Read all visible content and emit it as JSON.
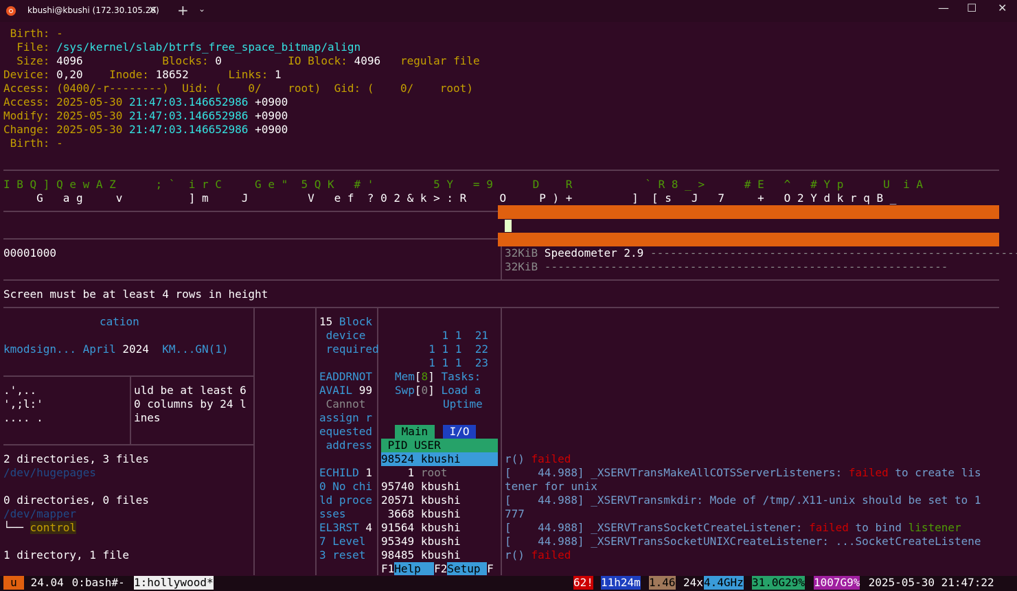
{
  "window": {
    "tab_title": "kbushi@kbushi (172.30.105.26)",
    "tab_close": "✕",
    "new_tab": "+",
    "dropdown": "⌄",
    "minimize": "—",
    "maximize": "☐",
    "close": "✕"
  },
  "stat": {
    "birth1_label": " Birth:",
    "birth1_val": " -",
    "file_label": "  File:",
    "file_val": " /sys/kernel/slab/btrfs_free_space_bitmap/align",
    "size_label": "  Size:",
    "size_val": " 4096",
    "blocks_label": "            Blocks:",
    "blocks_val": " 0",
    "ioblock_label": "          IO Block:",
    "ioblock_val": " 4096",
    "type": "   regular file",
    "device_label": "Device:",
    "device_val": " 0,20",
    "inode_label": "    Inode:",
    "inode_val": " 18652",
    "links_label": "      Links:",
    "links_val": " 1",
    "access_perm_label": "Access:",
    "access_perm_val": " (0400/-r--------)",
    "uid_label": "  Uid:",
    "uid_val": " (    0/    root)",
    "gid_label": "  Gid:",
    "gid_val": " (    0/    root)",
    "access_label": "Access:",
    "access_date": " 2025-05-30",
    "access_time": " 21:47:03.146652986",
    "access_tz": " +0900",
    "modify_label": "Modify:",
    "modify_date": " 2025-05-30",
    "modify_time": " 21:47:03.146652986",
    "modify_tz": " +0900",
    "change_label": "Change:",
    "change_date": " 2025-05-30",
    "change_time": " 21:47:03.146652986",
    "change_tz": " +0900",
    "birth2_label": " Birth:",
    "birth2_val": " -"
  },
  "rain": {
    "row1": "I B Q ] Q e w A Z      ; `  i r C     G e \"  5 Q K   # '         5 Y   = 9      D    R           ` R 8 _ >      # E   ^   # Y p      U  i A",
    "row2": "     G   a g     v          ] m     J         V   e f  ? 0 2 & k > : R     O     P ) +         ]  [ s   J   7     +   O 2 Y d k r q B _"
  },
  "hex_line": "00001000",
  "speedo": {
    "row1_size": "32KiB",
    "row1_label": " Speedometer 2.9",
    "row1_dash": " ---------------------------------------------------------",
    "row2_size": "32KiB",
    "row2_dash": " -------------------------------------------------------------"
  },
  "screen_msg": "Screen must be at least 4 rows in height",
  "man": {
    "cation": "cation",
    "name": "kmodsign...",
    "month": " April",
    "year": " 2024",
    "ref": "  KM...GN(1)"
  },
  "ascii": {
    "l1": ".',..",
    "l2": "',;l:'",
    "l3": ".... ."
  },
  "small_msg": {
    "l1": "uld be at least 6",
    "l2": "0 columns by 24 l",
    "l3": "ines"
  },
  "tree": {
    "l1": "2 directories, 3 files",
    "l2": "/dev/hugepages",
    "l3": "0 directories, 0 files",
    "l4": "/dev/mapper",
    "l5_branch": "└── ",
    "l5_name": "control",
    "l6": "1 directory, 1 file"
  },
  "errno": {
    "l1": "15 Block",
    "l2": " device",
    "l3": " required",
    "l4": "EADDRNOT",
    "l5": "AVAIL",
    "l5b": " 99",
    "l6": " Cannot",
    "l7": "assign r",
    "l8": "equested",
    "l9": " address",
    "l10": "ECHILD",
    "l10b": " 1",
    "l11": "0 No chi",
    "l12": "ld proce",
    "l13": "sses",
    "l14": "EL3RST",
    "l14b": " 4",
    "l15": "7 Level",
    "l16": "3 reset"
  },
  "htop": {
    "n1": "    1 1  21",
    "n2": "  1 1 1  22",
    "n3": "  1 1 1  23",
    "mem": "Mem",
    "mem_v": "8",
    "tasks": "Tasks:",
    "swp": "Swp",
    "swp_v": "0",
    "load": "Load a",
    "uptime": "Uptime",
    "tab_main": " Main ",
    "tab_io": " I/O ",
    "header": " PID USER   ",
    "rows": [
      {
        "pid": "98524",
        "user": "kbushi"
      },
      {
        "pid": "    1",
        "user": "root"
      },
      {
        "pid": "95740",
        "user": "kbushi"
      },
      {
        "pid": "20571",
        "user": "kbushi"
      },
      {
        "pid": " 3668",
        "user": "kbushi"
      },
      {
        "pid": "91564",
        "user": "kbushi"
      },
      {
        "pid": "95349",
        "user": "kbushi"
      },
      {
        "pid": "98485",
        "user": "kbushi"
      }
    ],
    "f1": "F1",
    "f1_label": "Help  ",
    "f2": "F2",
    "f2_label": "Setup ",
    "f3": "F"
  },
  "dmesg": {
    "l1a": "r()",
    "l1b": " failed",
    "l2a": "[    44.988]",
    "l2b": " _XSERVTransMakeAllCOTSServerListeners:",
    "l2c": " failed",
    "l2d": " to create lis",
    "l3": "tener for unix",
    "l4a": "[    44.988]",
    "l4b": " _XSERVTransmkdir: Mode of /tmp/.X11-unix should be set to 1",
    "l5": "777",
    "l6a": "[    44.988]",
    "l6b": " _XSERVTransSocketCreateListener:",
    "l6c": " failed",
    "l6d": " to bind",
    "l6e": " listener",
    "l7a": "[    44.988]",
    "l7b": " _XSERVTransSocketUNIXCreateListener: ...SocketCreateListene",
    "l8a": "r()",
    "l8b": " failed"
  },
  "status": {
    "session": "u",
    "ver": " 24.04",
    "win0": " 0:bash#-",
    "win1": "1:hollywood*",
    "warn": "62!",
    "uptime": "11h24m",
    "load": "1.46",
    "cpu_count": "24x",
    "freq": "4.4GHz",
    "mem": "31.0G29%",
    "disk": "1007G9%",
    "datetime": " 2025-05-30 21:47:22"
  },
  "colors": {
    "bg": "#300a24",
    "accent": "#e0600f",
    "green": "#4e9a06",
    "cyan": "#34e2e2"
  }
}
